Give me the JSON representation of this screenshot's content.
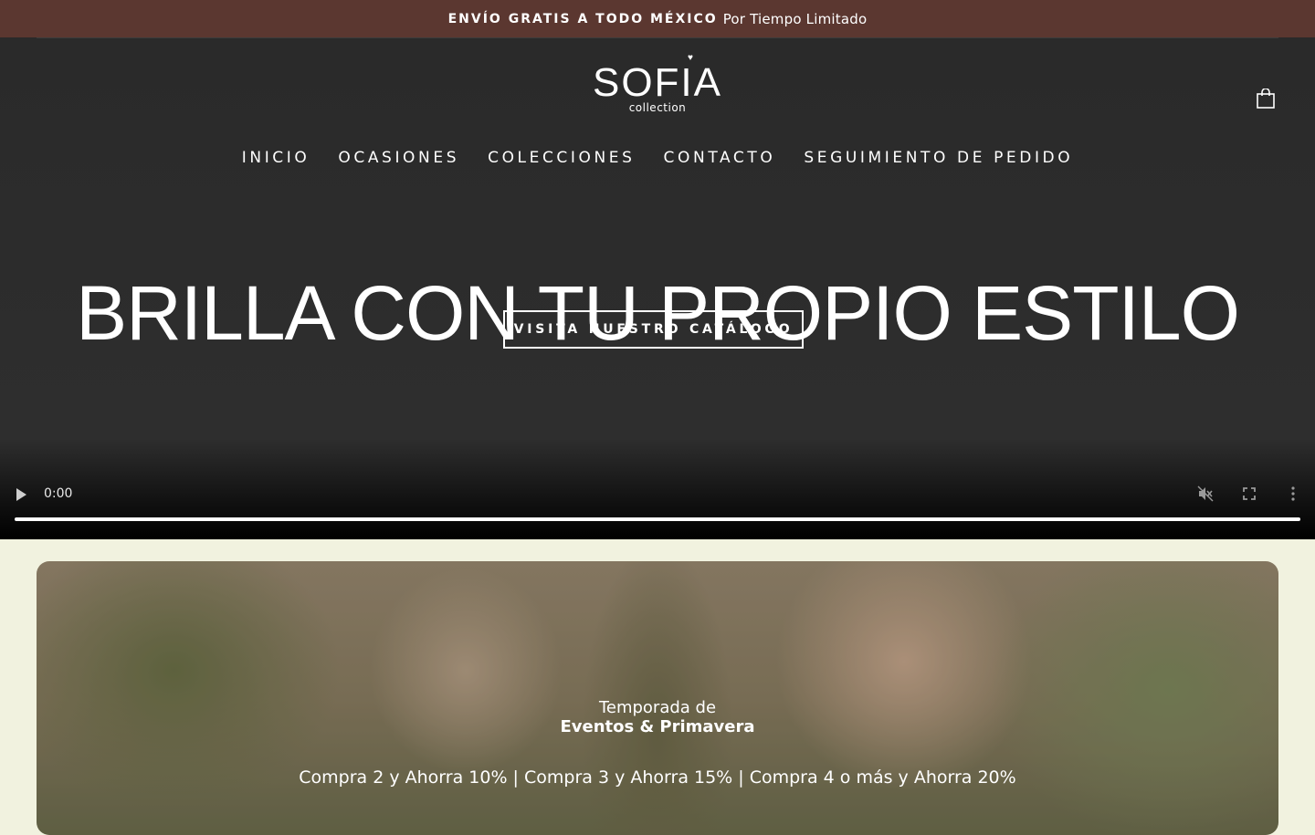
{
  "announcement": {
    "bold": "ENVÍO GRATIS A TODO MÉXICO",
    "rest": "Por Tiempo Limitado"
  },
  "header": {
    "logo_word": "SOFIA",
    "logo_sub": "collection",
    "cart_icon": "shopping-bag-icon"
  },
  "nav": {
    "items": [
      {
        "label": "INICIO"
      },
      {
        "label": "OCASIONES"
      },
      {
        "label": "COLECCIONES"
      },
      {
        "label": "CONTACTO"
      },
      {
        "label": "SEGUIMIENTO DE PEDIDO"
      }
    ]
  },
  "hero": {
    "headline": "BRILLA CON TU PROPIO ESTILO",
    "cta": "VISITA NUESTRO CATÁLOGO",
    "video": {
      "time": "0:00",
      "progress": 1.0,
      "icons": [
        "play-icon",
        "muted-icon",
        "fullscreen-icon",
        "more-options-icon"
      ]
    }
  },
  "promo": {
    "line1": "Temporada de",
    "line2": "Eventos & Primavera",
    "line3": "Compra 2 y Ahorra 10% | Compra 3 y Ahorra 15% | Compra 4 o más y Ahorra 20%"
  },
  "colors": {
    "announcement_bg": "#5b3730",
    "hero_bg": "#2a2a2a",
    "page_bg": "#f1f2df"
  }
}
